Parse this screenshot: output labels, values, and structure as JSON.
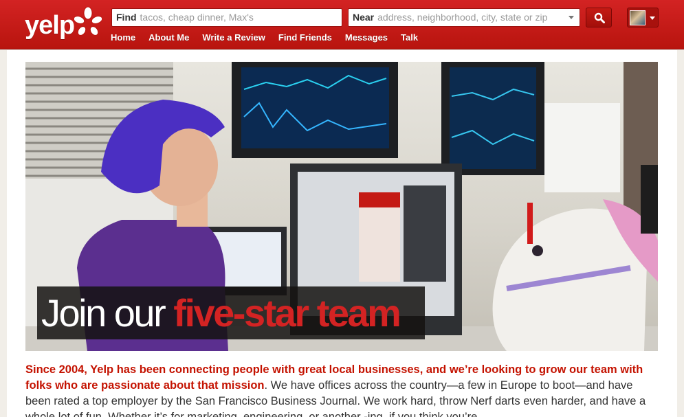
{
  "brand": {
    "logo_text": "yelp",
    "accent_color": "#d32323"
  },
  "search": {
    "find_label": "Find",
    "find_placeholder": "tacos, cheap dinner, Max's",
    "near_label": "Near",
    "near_placeholder": "address, neighborhood, city, state or zip",
    "search_icon": "search-icon"
  },
  "nav": [
    "Home",
    "About Me",
    "Write a Review",
    "Find Friends",
    "Messages",
    "Talk"
  ],
  "hero": {
    "title_plain": "Join our ",
    "title_accent": "five-star team"
  },
  "intro": {
    "lead": "Since 2004, Yelp has been connecting people with great local businesses, and we’re looking to grow our team with folks who are passionate about that mission",
    "body": ". We have offices across the country—a few in Europe to boot—and have been rated a top employer by the San Francisco Business Journal. We work hard, throw Nerf darts even harder, and have a whole lot of fun. Whether it’s for marketing, engineering, or another -ing, if you think you’re"
  }
}
